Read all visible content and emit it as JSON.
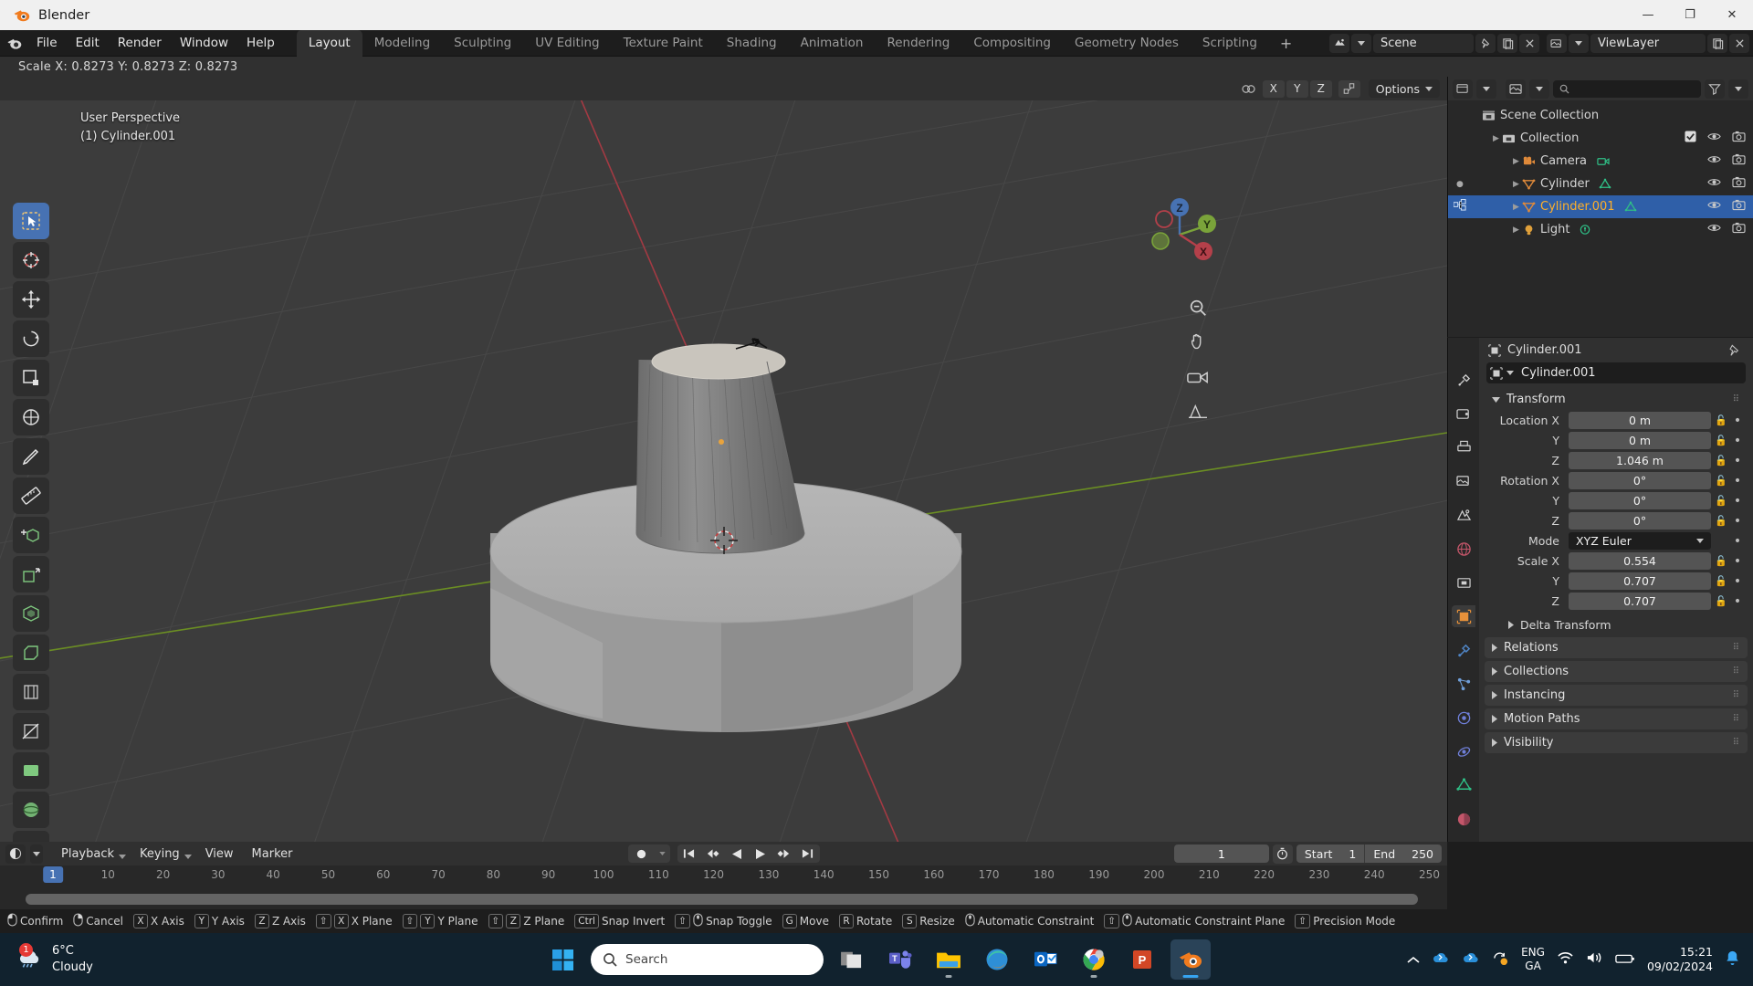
{
  "window": {
    "title": "Blender",
    "minimize": "—",
    "maximize": "❐",
    "close": "✕"
  },
  "topbar": {
    "menus": [
      "File",
      "Edit",
      "Render",
      "Window",
      "Help"
    ],
    "workspace_tabs": [
      {
        "label": "Layout",
        "active": true
      },
      {
        "label": "Modeling",
        "active": false
      },
      {
        "label": "Sculpting",
        "active": false
      },
      {
        "label": "UV Editing",
        "active": false
      },
      {
        "label": "Texture Paint",
        "active": false
      },
      {
        "label": "Shading",
        "active": false
      },
      {
        "label": "Animation",
        "active": false
      },
      {
        "label": "Rendering",
        "active": false
      },
      {
        "label": "Compositing",
        "active": false
      },
      {
        "label": "Geometry Nodes",
        "active": false
      },
      {
        "label": "Scripting",
        "active": false
      }
    ],
    "add_tab": "+",
    "scene_name": "Scene",
    "viewlayer_name": "ViewLayer"
  },
  "operator_feedback": "Scale X: 0.8273  Y: 0.8273  Z: 0.8273",
  "viewport": {
    "header": {
      "axis_buttons": [
        "X",
        "Y",
        "Z"
      ],
      "options_label": "Options"
    },
    "overlay": {
      "perspective": "User Perspective",
      "active_object": "(1) Cylinder.001"
    },
    "toolbar_tools": [
      "tweak-select-tool",
      "cursor-tool",
      "move-tool",
      "rotate-tool",
      "scale-tool",
      "transform-tool",
      "annotate-tool",
      "measure-tool",
      "add-cube-tool",
      "extrude-tool",
      "inset-tool",
      "bevel-tool",
      "loopcut-tool",
      "knife-tool",
      "poly-build-tool",
      "spin-tool",
      "smooth-tool",
      "shrink-fatten-tool"
    ],
    "gizmo_axes": [
      "X",
      "Y",
      "Z"
    ]
  },
  "outliner": {
    "search_placeholder": "",
    "rows": [
      {
        "name": "Scene Collection",
        "indent": 0,
        "type": "scene-collection",
        "selected": false,
        "has_tri": false,
        "checkbox": false,
        "eye": false,
        "camera": false
      },
      {
        "name": "Collection",
        "indent": 1,
        "type": "collection",
        "selected": false,
        "has_tri": true,
        "checkbox": true,
        "eye": true,
        "camera": true
      },
      {
        "name": "Camera",
        "indent": 2,
        "type": "camera",
        "selected": false,
        "has_tri": true,
        "checkbox": false,
        "eye": true,
        "camera": true
      },
      {
        "name": "Cylinder",
        "indent": 2,
        "type": "mesh",
        "selected": false,
        "has_tri": true,
        "checkbox": false,
        "eye": true,
        "camera": true
      },
      {
        "name": "Cylinder.001",
        "indent": 2,
        "type": "mesh",
        "selected": true,
        "has_tri": true,
        "checkbox": false,
        "eye": true,
        "camera": true
      },
      {
        "name": "Light",
        "indent": 2,
        "type": "light",
        "selected": false,
        "has_tri": true,
        "checkbox": false,
        "eye": true,
        "camera": true
      }
    ]
  },
  "properties": {
    "breadcrumb": "Cylinder.001",
    "id_name": "Cylinder.001",
    "transform": {
      "title": "Transform",
      "location_rows": [
        {
          "label": "Location X",
          "value": "0 m"
        },
        {
          "label": "Y",
          "value": "0 m"
        },
        {
          "label": "Z",
          "value": "1.046 m"
        }
      ],
      "rotation_rows": [
        {
          "label": "Rotation X",
          "value": "0°"
        },
        {
          "label": "Y",
          "value": "0°"
        },
        {
          "label": "Z",
          "value": "0°"
        }
      ],
      "mode_label": "Mode",
      "mode_value": "XYZ Euler",
      "scale_rows": [
        {
          "label": "Scale X",
          "value": "0.554"
        },
        {
          "label": "Y",
          "value": "0.707"
        },
        {
          "label": "Z",
          "value": "0.707"
        }
      ]
    },
    "collapsed_panels": [
      {
        "label": "Delta Transform",
        "sub": true
      },
      {
        "label": "Relations",
        "sub": false
      },
      {
        "label": "Collections",
        "sub": false
      },
      {
        "label": "Instancing",
        "sub": false
      },
      {
        "label": "Motion Paths",
        "sub": false
      },
      {
        "label": "Visibility",
        "sub": false
      }
    ],
    "tabs": [
      "tool-tab",
      "render-tab",
      "output-tab",
      "view-layer-tab",
      "scene-tab",
      "world-tab",
      "collection-tab",
      "object-tab",
      "modifiers-tab",
      "particles-tab",
      "physics-tab",
      "constraints-tab",
      "data-tab",
      "material-tab"
    ]
  },
  "timeline": {
    "menus": [
      "Playback",
      "Keying",
      "View",
      "Marker"
    ],
    "current_frame": "1",
    "start_label": "Start",
    "start_value": "1",
    "end_label": "End",
    "end_value": "250",
    "ticks": [
      "10",
      "20",
      "30",
      "40",
      "50",
      "60",
      "70",
      "80",
      "90",
      "100",
      "110",
      "120",
      "130",
      "140",
      "150",
      "160",
      "170",
      "180",
      "190",
      "200",
      "210",
      "220",
      "230",
      "240",
      "250"
    ],
    "playback_buttons": [
      "jump-start",
      "prev-keyframe",
      "play-reverse",
      "play",
      "next-keyframe",
      "jump-end"
    ]
  },
  "status_bar": {
    "items": [
      {
        "keys": [
          "mouse-left"
        ],
        "label": "Confirm"
      },
      {
        "keys": [
          "mouse-right"
        ],
        "label": "Cancel"
      },
      {
        "keys": [
          "X"
        ],
        "label": "X Axis"
      },
      {
        "keys": [
          "Y"
        ],
        "label": "Y Axis"
      },
      {
        "keys": [
          "Z"
        ],
        "label": "Z Axis"
      },
      {
        "keys": [
          "⇧",
          "X"
        ],
        "label": "X Plane"
      },
      {
        "keys": [
          "⇧",
          "Y"
        ],
        "label": "Y Plane"
      },
      {
        "keys": [
          "⇧",
          "Z"
        ],
        "label": "Z Plane"
      },
      {
        "keys": [
          "Ctrl"
        ],
        "label": "Snap Invert"
      },
      {
        "keys": [
          "⇧",
          "mouse-mid"
        ],
        "label": "Snap Toggle"
      },
      {
        "keys": [
          "G"
        ],
        "label": "Move"
      },
      {
        "keys": [
          "R"
        ],
        "label": "Rotate"
      },
      {
        "keys": [
          "S"
        ],
        "label": "Resize"
      },
      {
        "keys": [
          "mouse-mid"
        ],
        "label": "Automatic Constraint"
      },
      {
        "keys": [
          "⇧",
          "mouse-mid"
        ],
        "label": "Automatic Constraint Plane"
      },
      {
        "keys": [
          "⇧"
        ],
        "label": "Precision Mode"
      }
    ]
  },
  "taskbar": {
    "weather_temp": "6°C",
    "weather_desc": "Cloudy",
    "weather_badge": "1",
    "search_placeholder": "Search",
    "apps": [
      "task-view",
      "teams-app",
      "file-explorer-app",
      "edge-app",
      "outlook-app",
      "chrome-app",
      "powerpoint-app",
      "blender-app"
    ],
    "language": "ENG",
    "keyboard": "GA",
    "time": "15:21",
    "date": "09/02/2024"
  }
}
